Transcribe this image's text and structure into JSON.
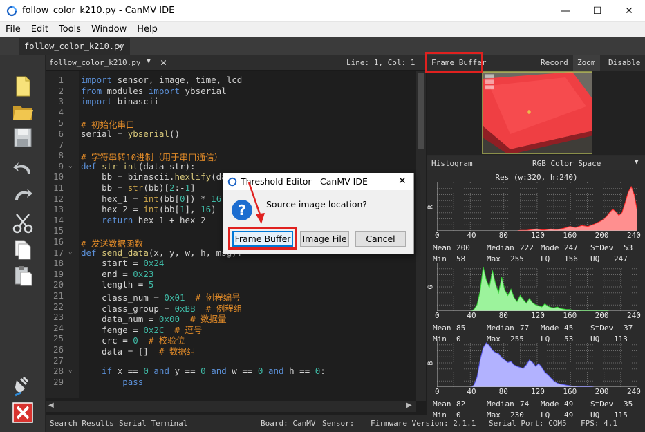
{
  "window": {
    "title": "follow_color_k210.py - CanMV IDE",
    "controls": {
      "minimize": "—",
      "maximize": "☐",
      "close": "✕"
    }
  },
  "menu": [
    "File",
    "Edit",
    "Tools",
    "Window",
    "Help"
  ],
  "tabs": [
    {
      "label": "follow_color_k210.py",
      "close": "✕"
    }
  ],
  "editor": {
    "file_select": "follow_color_k210.py",
    "cursor": "Line: 1, Col: 1",
    "lines": [
      {
        "n": "1",
        "html": "<span class=\"kw\">import</span> sensor, image, time, lcd"
      },
      {
        "n": "2",
        "html": "<span class=\"kw\">from</span> modules <span class=\"kw\">import</span> ybserial"
      },
      {
        "n": "3",
        "html": "<span class=\"kw\">import</span> binascii"
      },
      {
        "n": "4",
        "html": ""
      },
      {
        "n": "5",
        "html": "<span class=\"cm\"># 初始化串口</span>"
      },
      {
        "n": "6",
        "html": "serial = <span class=\"fnn\">ybserial</span>()"
      },
      {
        "n": "7",
        "html": ""
      },
      {
        "n": "8",
        "html": "<span class=\"cm\"># 字符串转10进制（用于串口通信）</span>"
      },
      {
        "n": "9",
        "fold": true,
        "html": "<span class=\"kw\">def</span> <span class=\"fnn\">str_int</span>(data_str):"
      },
      {
        "n": "10",
        "html": "    bb = binascii.<span class=\"fnn\">hexlify</span>(data_str)"
      },
      {
        "n": "11",
        "html": "    bb = <span class=\"bi\">str</span>(bb)[<span class=\"nm\">2</span>:-<span class=\"nm\">1</span>]"
      },
      {
        "n": "12",
        "html": "    hex_1 = <span class=\"bi\">int</span>(bb[<span class=\"nm\">0</span>]) * <span class=\"nm\">16</span>"
      },
      {
        "n": "13",
        "html": "    hex_2 = <span class=\"bi\">int</span>(bb[<span class=\"nm\">1</span>], <span class=\"nm\">16</span>)"
      },
      {
        "n": "14",
        "html": "    <span class=\"kw\">return</span> hex_1 + hex_2"
      },
      {
        "n": "15",
        "html": ""
      },
      {
        "n": "16",
        "html": "<span class=\"cm\"># 发送数据函数</span>"
      },
      {
        "n": "17",
        "fold": true,
        "html": "<span class=\"kw\">def</span> <span class=\"fnn\">send_data</span>(x, y, w, h, msg):"
      },
      {
        "n": "18",
        "html": "    start = <span class=\"nm\">0x24</span>"
      },
      {
        "n": "19",
        "html": "    end = <span class=\"nm\">0x23</span>"
      },
      {
        "n": "20",
        "html": "    length = <span class=\"nm\">5</span>"
      },
      {
        "n": "21",
        "html": "    class_num = <span class=\"nm\">0x01</span>  <span class=\"cm\"># 例程编号</span>"
      },
      {
        "n": "22",
        "html": "    class_group = <span class=\"nm\">0xBB</span>  <span class=\"cm\"># 例程组</span>"
      },
      {
        "n": "23",
        "html": "    data_num = <span class=\"nm\">0x00</span>  <span class=\"cm\"># 数据量</span>"
      },
      {
        "n": "24",
        "html": "    fenge = <span class=\"nm\">0x2C</span>  <span class=\"cm\"># 逗号</span>"
      },
      {
        "n": "25",
        "html": "    crc = <span class=\"nm\">0</span>  <span class=\"cm\"># 校验位</span>"
      },
      {
        "n": "26",
        "html": "    data = []  <span class=\"cm\"># 数据组</span>"
      },
      {
        "n": "27",
        "html": ""
      },
      {
        "n": "28",
        "fold": true,
        "html": "    <span class=\"kw\">if</span> x == <span class=\"nm\">0</span> <span class=\"kw\">and</span> y == <span class=\"nm\">0</span> <span class=\"kw\">and</span> w == <span class=\"nm\">0</span> <span class=\"kw\">and</span> h == <span class=\"nm\">0</span>:"
      },
      {
        "n": "29",
        "html": "        <span class=\"kw\">pass</span>"
      }
    ]
  },
  "status": {
    "search_results": "Search Results",
    "serial_terminal": "Serial Terminal",
    "board": "Board: CanMV",
    "sensor": "Sensor:",
    "firmware": "Firmware Version: 2.1.1",
    "serial_port": "Serial Port: COM5",
    "fps": "FPS:   4.1"
  },
  "framebuffer": {
    "title": "Frame Buffer",
    "record": "Record",
    "zoom": "Zoom",
    "disable": "Disable"
  },
  "histogram": {
    "label": "Histogram",
    "colorspace": "RGB Color Space",
    "resolution": "Res (w:320, h:240)",
    "ticks": [
      "0",
      "40",
      "80",
      "120",
      "160",
      "200",
      "240"
    ],
    "channels": [
      {
        "name": "R",
        "color": "#ff8f8f",
        "stroke": "#ff2a2a",
        "shape": [
          0,
          0,
          0,
          0,
          0,
          0,
          0,
          0,
          0,
          0,
          0,
          0,
          0,
          0,
          0,
          0,
          0,
          0,
          0,
          0,
          0,
          0,
          0,
          0,
          0,
          0,
          0,
          1,
          1,
          1,
          2,
          3,
          4,
          3,
          2,
          2,
          3,
          4,
          3,
          3,
          4,
          5,
          7,
          9,
          8,
          7,
          9,
          11,
          10,
          9,
          12,
          14,
          17,
          20,
          24,
          30,
          38,
          45,
          40,
          32,
          38,
          58,
          80,
          92,
          75,
          40
        ],
        "stats": {
          "mean": "200",
          "median": "222",
          "mode": "247",
          "stdev": "53",
          "min": "58",
          "max": "255",
          "lq": "156",
          "uq": "247"
        }
      },
      {
        "name": "G",
        "color": "#9cf39c",
        "stroke": "#36d436",
        "shape": [
          0,
          0,
          0,
          0,
          0,
          0,
          0,
          0,
          0,
          0,
          0,
          0,
          3,
          12,
          38,
          85,
          60,
          45,
          78,
          52,
          35,
          65,
          40,
          30,
          42,
          26,
          18,
          30,
          22,
          15,
          24,
          16,
          12,
          10,
          8,
          14,
          9,
          7,
          6,
          8,
          5,
          4,
          3,
          3,
          2,
          2,
          2,
          1,
          1,
          1,
          1,
          1,
          1,
          1,
          1,
          1,
          0,
          0,
          0,
          0,
          0,
          0,
          0,
          0,
          0,
          0
        ],
        "stats": {
          "mean": "85",
          "median": "77",
          "mode": "45",
          "stdev": "37",
          "min": "0",
          "max": "255",
          "lq": "53",
          "uq": "113"
        }
      },
      {
        "name": "B",
        "color": "#b2b2ff",
        "stroke": "#5a5af0",
        "shape": [
          0,
          0,
          0,
          0,
          0,
          0,
          0,
          0,
          0,
          0,
          0,
          0,
          4,
          20,
          55,
          80,
          90,
          85,
          75,
          70,
          68,
          60,
          55,
          50,
          52,
          45,
          42,
          40,
          38,
          45,
          55,
          50,
          42,
          48,
          40,
          30,
          25,
          18,
          12,
          8,
          6,
          5,
          4,
          3,
          2,
          2,
          1,
          1,
          1,
          1,
          1,
          0,
          0,
          0,
          0,
          0,
          0,
          0,
          0,
          0,
          0,
          0,
          0,
          0,
          0,
          0
        ],
        "stats": {
          "mean": "82",
          "median": "74",
          "mode": "49",
          "stdev": "35",
          "min": "0",
          "max": "230",
          "lq": "49",
          "uq": "115"
        }
      }
    ],
    "stat_labels": {
      "mean": "Mean",
      "median": "Median",
      "mode": "Mode",
      "stdev": "StDev",
      "min": "Min",
      "max": "Max",
      "lq": "LQ",
      "uq": "UQ"
    }
  },
  "dialog": {
    "title": "Threshold Editor - CanMV IDE",
    "close": "✕",
    "message": "Source image location?",
    "buttons": {
      "frame_buffer": "Frame Buffer",
      "image_file": "Image File",
      "cancel": "Cancel"
    }
  },
  "colors": {
    "annotation": "#e0211f",
    "accent": "#0078d7"
  }
}
